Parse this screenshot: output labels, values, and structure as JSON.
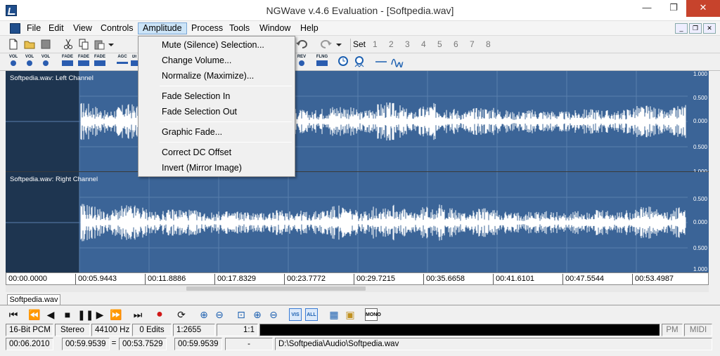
{
  "window": {
    "title": "NGWave v.4.6 Evaluation - [Softpedia.wav]",
    "min": "—",
    "max": "❐",
    "close": "✕"
  },
  "menu": [
    "File",
    "Edit",
    "View",
    "Controls",
    "Amplitude",
    "Process",
    "Tools",
    "Window",
    "Help"
  ],
  "mdi_buttons": [
    "_",
    "❐",
    "✕"
  ],
  "toolbar": {
    "set_label": "Set",
    "set_numbers": [
      "1",
      "2",
      "3",
      "4",
      "5",
      "6",
      "7",
      "8"
    ]
  },
  "toolbar2_labels": [
    "VOL",
    "VOL",
    "VOL",
    "FADE",
    "FADE",
    "FADE",
    "AGC",
    "DI",
    "REV",
    "FLNG"
  ],
  "amplitude_menu": {
    "items": [
      "Mute (Silence) Selection...",
      "Change Volume...",
      "Normalize (Maximize)...",
      "Fade Selection In",
      "Fade Selection Out",
      "Graphic Fade...",
      "Correct DC Offset",
      "Invert (Mirror Image)"
    ]
  },
  "channels": {
    "left": {
      "label": "Softpedia.wav: Left Channel"
    },
    "right": {
      "label": "Softpedia.wav: Right Channel"
    },
    "scale": [
      "1.000",
      "0.500",
      "0.000",
      "0.500",
      "1.000"
    ]
  },
  "colors": {
    "wave_bg": "#3b6497",
    "wave_gutter": "#1e3550",
    "waveform": "#ffffff",
    "close_btn": "#c7432c"
  },
  "timeline": [
    "00:00.0000",
    "00:05.9443",
    "00:11.8886",
    "00:17.8329",
    "00:23.7772",
    "00:29.7215",
    "00:35.6658",
    "00:41.6101",
    "00:47.5544",
    "00:53.4987"
  ],
  "doc_tab": "Softpedia.wav",
  "transport": {
    "icons": [
      "skip-start-icon",
      "rewind-icon",
      "play-reverse-icon",
      "stop-icon",
      "pause-icon",
      "play-icon",
      "fast-forward-icon",
      "skip-end-icon",
      "record-icon",
      "loop-icon",
      "zoom-in-icon",
      "zoom-out-icon",
      "zoom-selection-icon",
      "zoom-in-vertical-icon",
      "zoom-out-vertical-icon",
      "vis-icon",
      "all-icon",
      "settings-icon",
      "export-icon",
      "mono-icon"
    ],
    "vis_label": "VIS",
    "all_label": "ALL",
    "mono_label": "MONO"
  },
  "status": {
    "format": "16-Bit PCM",
    "channels": "Stereo",
    "rate": "44100 Hz",
    "edits": "0 Edits",
    "zoom": "1:2655",
    "ratio": "1:1",
    "pm": "PM",
    "midi": "MIDI",
    "pos": "00:06.2010",
    "sel_start": "00:59.9539",
    "eq": "=",
    "sel_len": "00:53.7529",
    "total": "00:59.9539",
    "dash": "-",
    "path": "D:\\Softpedia\\Audio\\Softpedia.wav"
  }
}
